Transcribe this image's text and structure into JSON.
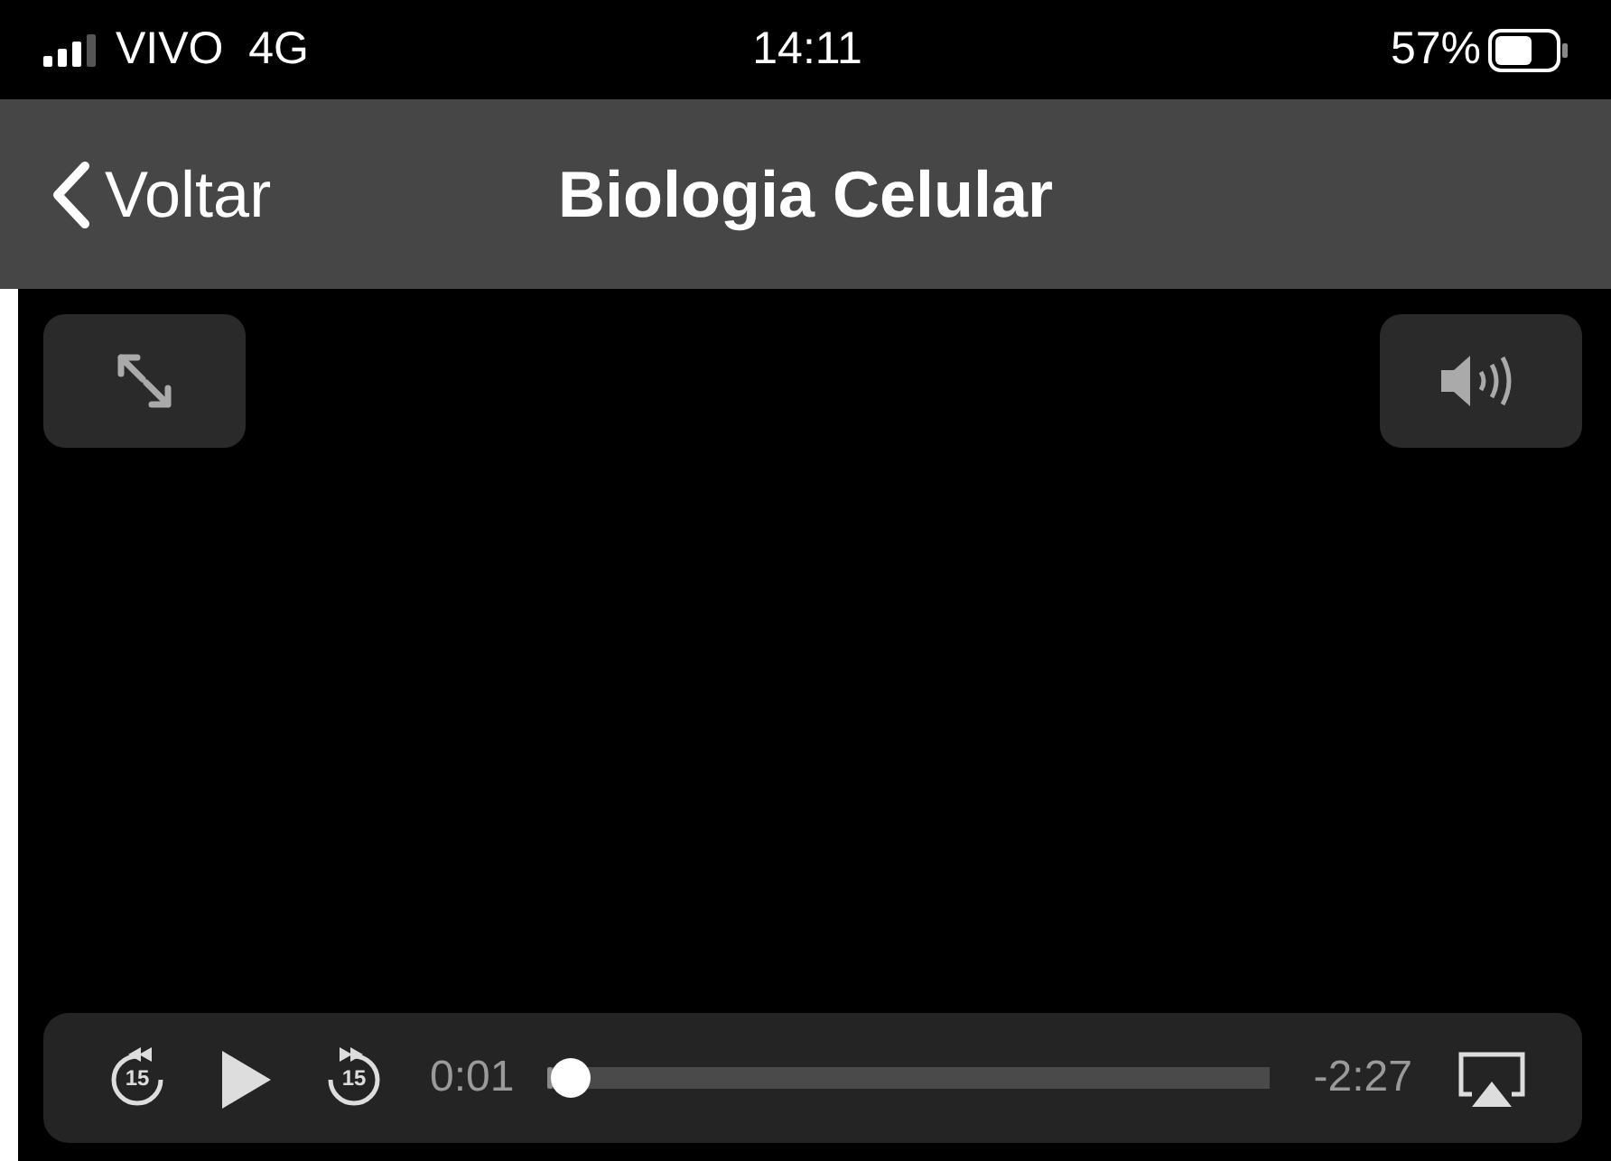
{
  "status_bar": {
    "carrier": "VIVO  4G",
    "time": "14:11",
    "battery": "57%"
  },
  "nav_bar": {
    "back_label": "Voltar",
    "title": "Biologia Celular"
  },
  "player": {
    "skip_back": "15",
    "skip_forward": "15",
    "elapsed": "0:01",
    "remaining": "-2:27",
    "level": 0.007
  }
}
